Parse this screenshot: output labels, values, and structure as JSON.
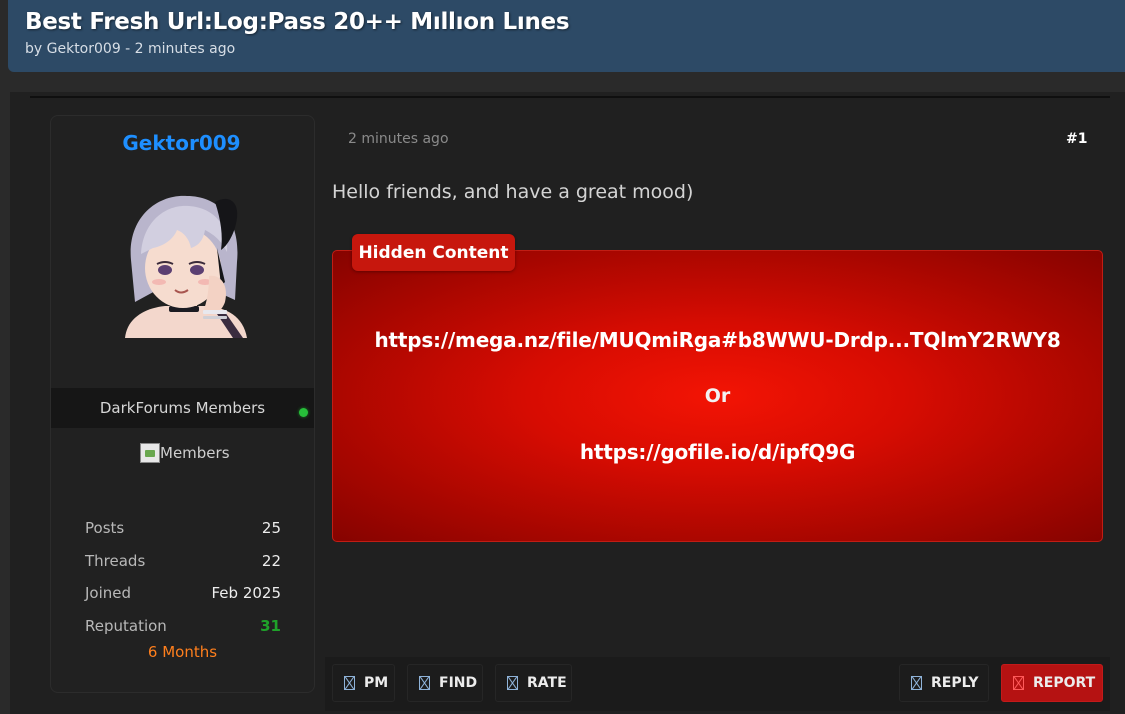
{
  "thread": {
    "title": "Best Fresh Url:Log:Pass 20++ Mıllıon Lınes",
    "byline": "by Gektor009 - 2 minutes ago"
  },
  "user": {
    "username": "Gektor009",
    "avatar_icon": "anime-avatar",
    "group_name": "DarkForums Members",
    "online": true,
    "group_image_alt": "Members",
    "stats": [
      {
        "label": "Posts",
        "value": "25"
      },
      {
        "label": "Threads",
        "value": "22"
      },
      {
        "label": "Joined",
        "value": "Feb 2025"
      },
      {
        "label": "Reputation",
        "value": "31"
      }
    ],
    "tenure": "6 Months",
    "colors": {
      "username": "#1e8fff",
      "reputation": "#1fa12a",
      "tenure": "#ff7f1d",
      "online": "#27c03a"
    }
  },
  "post": {
    "time": "2 minutes ago",
    "number": "#1",
    "message": "Hello friends, and have a great mood)",
    "hidden_content": {
      "label": "Hidden Content",
      "link1": "https://mega.nz/file/MUQmiRga#b8WWU-Drdp...TQlmY2RWY8",
      "separator": "Or",
      "link2": "https://gofile.io/d/ipfQ9G"
    }
  },
  "actions": {
    "pm": "PM",
    "find": "FIND",
    "rate": "RATE",
    "reply": "REPLY",
    "report": "REPORT"
  }
}
